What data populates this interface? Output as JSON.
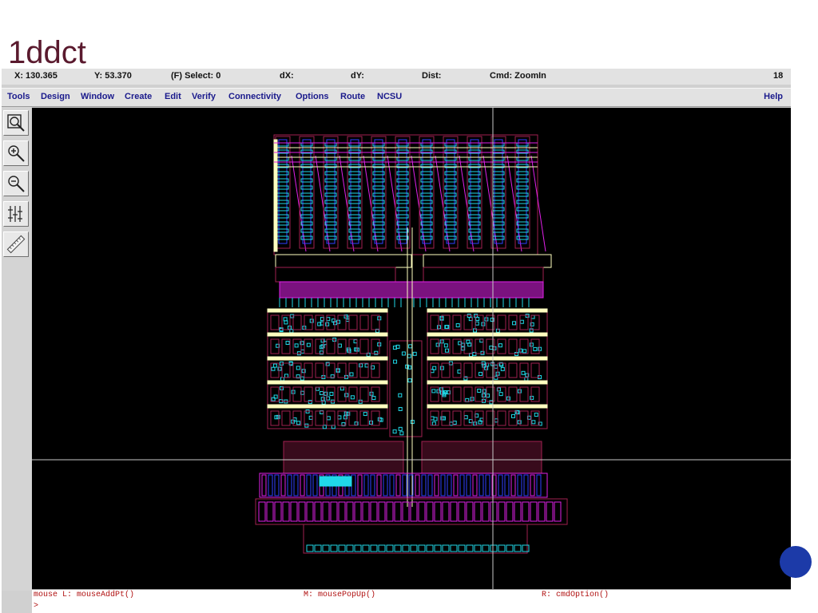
{
  "slide": {
    "title": "1ddct"
  },
  "status_bar": {
    "x": "X:  130.365",
    "y": "Y:  53.370",
    "select": "(F) Select: 0",
    "dx": "dX:",
    "dy": "dY:",
    "dist": "Dist:",
    "cmd": "Cmd: ZoomIn",
    "number": "18"
  },
  "menu": {
    "items": [
      "Tools",
      "Design",
      "Window",
      "Create",
      "Edit",
      "Verify",
      "Connectivity",
      "Options",
      "Route",
      "NCSU"
    ],
    "help": "Help"
  },
  "tools": [
    "zoom-fit-icon",
    "zoom-in-icon",
    "zoom-out-icon",
    "grid-icon",
    "ruler-icon"
  ],
  "mouse_bar": {
    "left": "mouse L: mouseAddPt()",
    "middle": "M: mousePopUp()",
    "right": "R: cmdOption()"
  },
  "command_line": {
    "prompt": ">"
  },
  "colors": {
    "canvas": "#000000",
    "metal1": "#20d8e8",
    "metal2": "#e020e8",
    "poly": "#ffffc0",
    "diffusion": "#a02050",
    "active": "#3040ff",
    "crosshair": "#c8c8c8"
  }
}
